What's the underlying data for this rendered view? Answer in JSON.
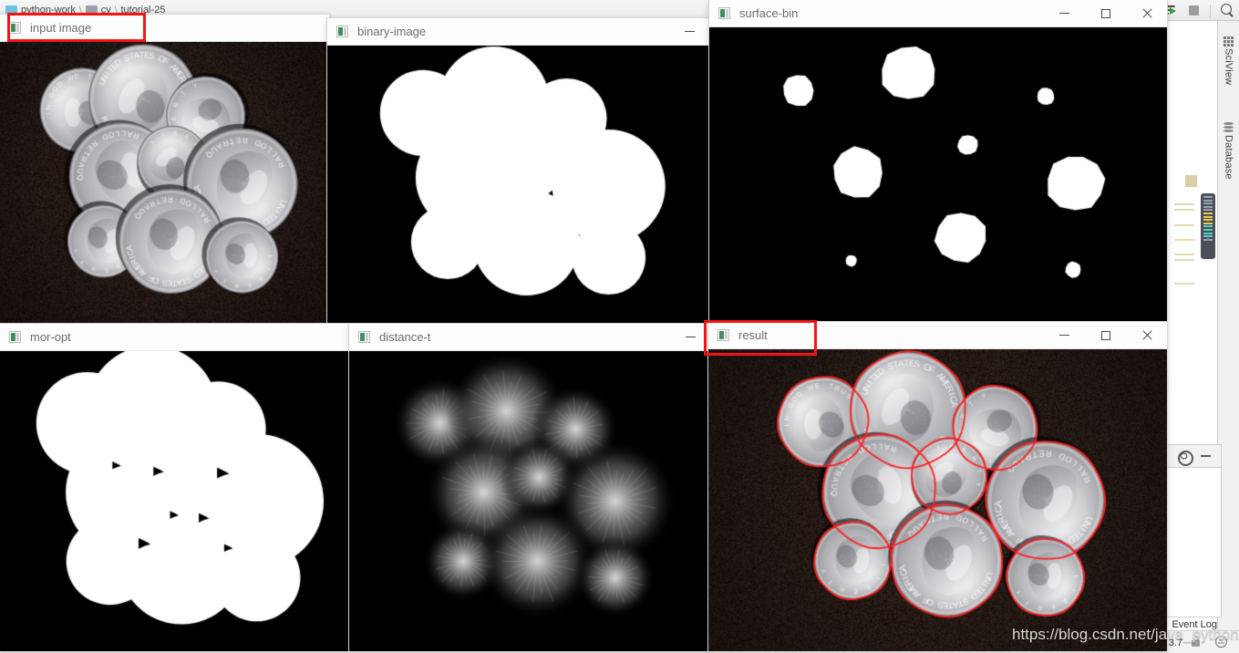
{
  "ide": {
    "breadcrumb": [
      "python-work",
      "cv",
      "tutorial-25"
    ],
    "toolbar_icons": [
      "run-window-icon",
      "stop-icon",
      "search-everywhere-icon"
    ],
    "right_stripe": [
      {
        "label": "SciView",
        "icon": "grid-icon"
      },
      {
        "label": "Database",
        "icon": "database-icon"
      }
    ],
    "bottom_panel": {
      "gear_label": "settings-icon",
      "minimize_label": "minimize-icon"
    },
    "status": {
      "event_log": "Event Log",
      "interpreter": "3.7"
    },
    "watermark": "https://blog.csdn.net/java_pythons"
  },
  "windows": [
    {
      "id": "input-image",
      "title": "input image",
      "controls": [],
      "highlighted": true,
      "content": "coins-photo"
    },
    {
      "id": "binary-image",
      "title": "binary-image",
      "controls": [
        "minimize"
      ],
      "highlighted": false,
      "content": "binary-circles"
    },
    {
      "id": "surface-bin",
      "title": "surface-bin",
      "controls": [
        "minimize",
        "maximize",
        "close"
      ],
      "highlighted": false,
      "content": "surface-dots"
    },
    {
      "id": "mor-opt",
      "title": "mor-opt",
      "controls": [],
      "highlighted": false,
      "content": "morph-blob"
    },
    {
      "id": "distance-t",
      "title": "distance-t",
      "controls": [
        "minimize"
      ],
      "highlighted": false,
      "content": "distance-transform"
    },
    {
      "id": "result",
      "title": "result",
      "controls": [
        "minimize",
        "maximize",
        "close"
      ],
      "highlighted": true,
      "content": "coins-contoured"
    }
  ],
  "colors": {
    "annotation_red": "#f51313",
    "contour_red": "#ff2020",
    "window_bg": "#ffffff",
    "image_bg": "#000000",
    "title_text": "#6b6b6b"
  },
  "image_content": {
    "coins": [
      {
        "cx": 0.25,
        "cy": 0.24,
        "r": 0.105,
        "type": "nickel",
        "rot": -20
      },
      {
        "cx": 0.435,
        "cy": 0.2,
        "r": 0.135,
        "type": "quarter",
        "rot": 8
      },
      {
        "cx": 0.625,
        "cy": 0.26,
        "r": 0.098,
        "type": "dime",
        "rot": -95
      },
      {
        "cx": 0.372,
        "cy": 0.47,
        "r": 0.132,
        "type": "quarter",
        "rot": 145
      },
      {
        "cx": 0.525,
        "cy": 0.42,
        "r": 0.088,
        "type": "dime",
        "rot": 30
      },
      {
        "cx": 0.735,
        "cy": 0.5,
        "r": 0.138,
        "type": "quarter",
        "rot": 190
      },
      {
        "cx": 0.315,
        "cy": 0.7,
        "r": 0.09,
        "type": "dime",
        "rot": 175
      },
      {
        "cx": 0.52,
        "cy": 0.7,
        "r": 0.13,
        "type": "quarter",
        "rot": 185
      },
      {
        "cx": 0.735,
        "cy": 0.755,
        "r": 0.09,
        "type": "dime",
        "rot": 165
      }
    ],
    "surface_dots": [
      {
        "cx": 0.195,
        "cy": 0.215,
        "r": 0.036
      },
      {
        "cx": 0.435,
        "cy": 0.155,
        "r": 0.062
      },
      {
        "cx": 0.735,
        "cy": 0.235,
        "r": 0.02
      },
      {
        "cx": 0.565,
        "cy": 0.4,
        "r": 0.023
      },
      {
        "cx": 0.325,
        "cy": 0.495,
        "r": 0.058
      },
      {
        "cx": 0.8,
        "cy": 0.53,
        "r": 0.065
      },
      {
        "cx": 0.31,
        "cy": 0.795,
        "r": 0.013
      },
      {
        "cx": 0.55,
        "cy": 0.715,
        "r": 0.058
      },
      {
        "cx": 0.795,
        "cy": 0.825,
        "r": 0.018
      }
    ]
  }
}
